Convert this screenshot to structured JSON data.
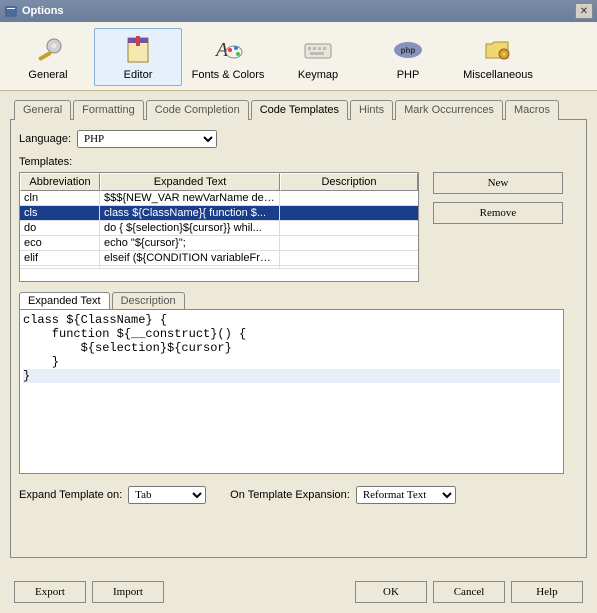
{
  "titlebar": {
    "title": "Options"
  },
  "toolbar": {
    "items": [
      {
        "label": "General"
      },
      {
        "label": "Editor"
      },
      {
        "label": "Fonts & Colors"
      },
      {
        "label": "Keymap"
      },
      {
        "label": "PHP"
      },
      {
        "label": "Miscellaneous"
      }
    ]
  },
  "tabs": {
    "items": [
      "General",
      "Formatting",
      "Code Completion",
      "Code Templates",
      "Hints",
      "Mark Occurrences",
      "Macros"
    ],
    "active": "Code Templates"
  },
  "language": {
    "label": "Language:",
    "value": "PHP"
  },
  "templates": {
    "label": "Templates:",
    "columns": [
      "Abbreviation",
      "Expanded Text",
      "Description"
    ],
    "rows": [
      {
        "abbr": "cln",
        "expanded": "$$${NEW_VAR newVarName defa...",
        "desc": ""
      },
      {
        "abbr": "cls",
        "expanded": "class ${ClassName}{    function $...",
        "desc": "",
        "selected": true
      },
      {
        "abbr": "do",
        "expanded": "do {    ${selection}${cursor}} whil...",
        "desc": ""
      },
      {
        "abbr": "eco",
        "expanded": "echo \"${cursor}\";",
        "desc": ""
      },
      {
        "abbr": "elif",
        "expanded": "elseif (${CONDITION variableFro...",
        "desc": ""
      },
      {
        "abbr": "",
        "expanded": "",
        "desc": ""
      }
    ]
  },
  "buttons": {
    "new": "New",
    "remove": "Remove"
  },
  "subtabs": {
    "items": [
      "Expanded Text",
      "Description"
    ],
    "active": "Expanded Text"
  },
  "code": {
    "lines": [
      "class ${ClassName} {",
      "    function ${__construct}() {",
      "        ${selection}${cursor}",
      "    }",
      "}"
    ],
    "highlighted": 4
  },
  "expand": {
    "label": "Expand Template on:",
    "value": "Tab",
    "onExpLabel": "On Template Expansion:",
    "onExpValue": "Reformat Text"
  },
  "dialog": {
    "export": "Export",
    "import": "Import",
    "ok": "OK",
    "cancel": "Cancel",
    "help": "Help"
  }
}
